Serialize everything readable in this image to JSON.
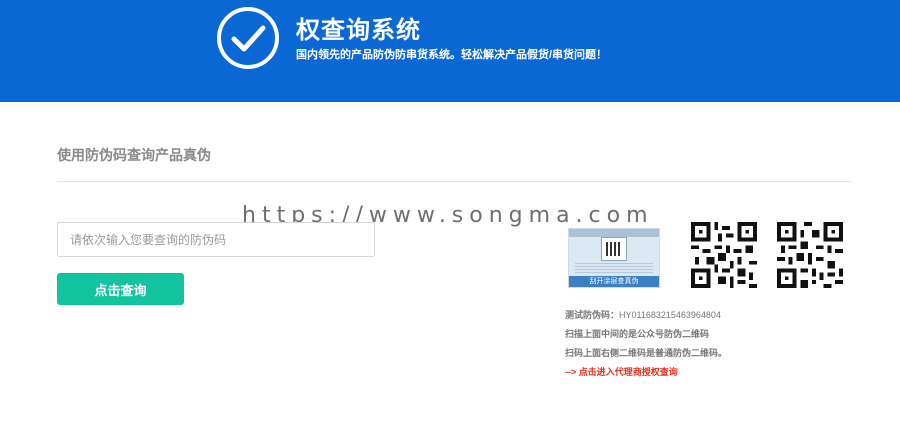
{
  "header": {
    "title": "权查询系统",
    "subtitle": "国内领先的产品防伪防串货系统。轻松解决产品假货/串货问题！",
    "logo_icon": "check-circle-icon",
    "background": "#0a68d4"
  },
  "section": {
    "title": "使用防伪码查询产品真伪"
  },
  "watermark": "https://www.songma.com",
  "search": {
    "placeholder": "请依次输入您要查询的防伪码",
    "value": ""
  },
  "query_button": {
    "label": "点击查询",
    "color": "#13c3a0"
  },
  "sample_label": {
    "caption": "刮开涂层查真伪"
  },
  "info": {
    "test_code_label": "测试防伪码：",
    "test_code_value": "HY011683215463964804",
    "line1": "扫描上面中间的是公众号防伪二维码",
    "line2": "扫码上面右侧二维码是普通防伪二维码。",
    "agent_link": "--> 点击进入代理商授权查询",
    "link_color": "#e8321e"
  }
}
